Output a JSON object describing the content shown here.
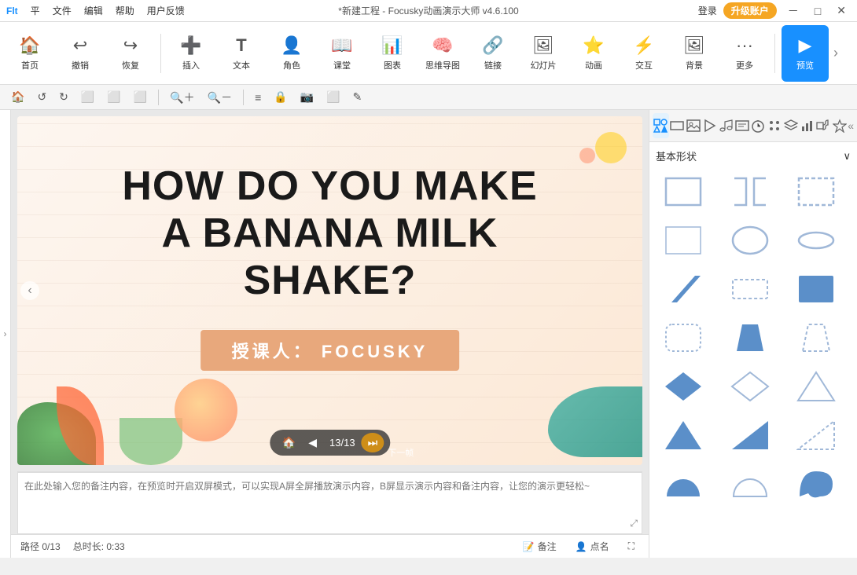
{
  "app": {
    "title": "*新建工程 - Focusky动画演示大师 v4.6.100",
    "platform_icon": "Flt"
  },
  "titlebar": {
    "menu_items": [
      "平",
      "文件",
      "编辑",
      "帮助",
      "用户反馈"
    ],
    "login_label": "登录",
    "upgrade_label": "升级账户",
    "min_btn": "－",
    "max_btn": "□",
    "close_btn": "✕"
  },
  "toolbar": {
    "items": [
      {
        "label": "首页",
        "icon": "🏠"
      },
      {
        "label": "撤销",
        "icon": "↩"
      },
      {
        "label": "恢复",
        "icon": "↪"
      },
      {
        "label": "插入",
        "icon": "＋"
      },
      {
        "label": "文本",
        "icon": "T"
      },
      {
        "label": "角色",
        "icon": "👤"
      },
      {
        "label": "课堂",
        "icon": "📖"
      },
      {
        "label": "图表",
        "icon": "📊"
      },
      {
        "label": "思维导图",
        "icon": "🧠"
      },
      {
        "label": "链接",
        "icon": "🔗"
      },
      {
        "label": "幻灯片",
        "icon": "🖼"
      },
      {
        "label": "动画",
        "icon": "⭐"
      },
      {
        "label": "交互",
        "icon": "⚡"
      },
      {
        "label": "背景",
        "icon": "🖼"
      },
      {
        "label": "更多",
        "icon": "···"
      },
      {
        "label": "预览",
        "icon": "▶"
      }
    ]
  },
  "toolbar2": {
    "buttons": [
      "🏠",
      "↺",
      "↺",
      "⬜",
      "⬜",
      "⬜",
      "🔍+",
      "🔍-",
      "≡",
      "🔒",
      "📷",
      "⬜",
      "✎"
    ]
  },
  "slide": {
    "title_line1": "HOW DO YOU MAKE",
    "title_line2": "A BANANA MILK",
    "title_line3": "SHAKE?",
    "subtitle": "授课人： FOCUSKY"
  },
  "preview_controls": {
    "home_icon": "🏠",
    "prev_icon": "◀",
    "page_current": "13",
    "page_total": "13",
    "next_icon": "⏭",
    "next_label": "下一帧"
  },
  "notes": {
    "placeholder": "在此处输入您的备注内容，在预览时开启双屏模式，可以实现A屏全屏播放演示内容，B屏显示演示内容和备注内容，让您的演示更轻松~"
  },
  "statusbar": {
    "path": "路径 0/13",
    "duration": "总时长: 0:33",
    "notes_btn": "备注",
    "roll_btn": "点名",
    "fullscreen_btn": "⛶"
  },
  "right_panel": {
    "category_label": "基本形状",
    "expand_icon": "∨",
    "toolbar_icons": [
      "shapes",
      "rectangle",
      "image",
      "play",
      "music",
      "text",
      "timer",
      "grid",
      "layers",
      "chart",
      "unknown",
      "star"
    ],
    "shapes": [
      {
        "type": "rect-outline",
        "color": "#a0b8d8"
      },
      {
        "type": "bracket-outline",
        "color": "#a0b8d8"
      },
      {
        "type": "rect-dashed",
        "color": "#a0b8d8"
      },
      {
        "type": "rect-thin",
        "color": "#a0b8d8"
      },
      {
        "type": "circle-outline",
        "color": "#a0b8d8"
      },
      {
        "type": "oval-outline",
        "color": "#a0b8d8"
      },
      {
        "type": "parallelogram",
        "color": "#5b8fc9"
      },
      {
        "type": "rect-dashed2",
        "color": "#a0b8d8"
      },
      {
        "type": "rect-solid",
        "color": "#5b8fc9"
      },
      {
        "type": "rect-dashed3",
        "color": "#a0b8d8"
      },
      {
        "type": "trapezoid",
        "color": "#5b8fc9"
      },
      {
        "type": "trapezoid-dashed",
        "color": "#a0b8d8"
      },
      {
        "type": "diamond",
        "color": "#5b8fc9"
      },
      {
        "type": "diamond-outline",
        "color": "#a0b8d8"
      },
      {
        "type": "triangle-outline",
        "color": "#a0b8d8"
      },
      {
        "type": "triangle-solid",
        "color": "#5b8fc9"
      },
      {
        "type": "triangle-right",
        "color": "#5b8fc9"
      },
      {
        "type": "triangle-right-dashed",
        "color": "#a0b8d8"
      },
      {
        "type": "semicircle",
        "color": "#5b8fc9"
      },
      {
        "type": "semicircle-outline",
        "color": "#a0b8d8"
      },
      {
        "type": "shape-misc",
        "color": "#5b8fc9"
      }
    ]
  }
}
